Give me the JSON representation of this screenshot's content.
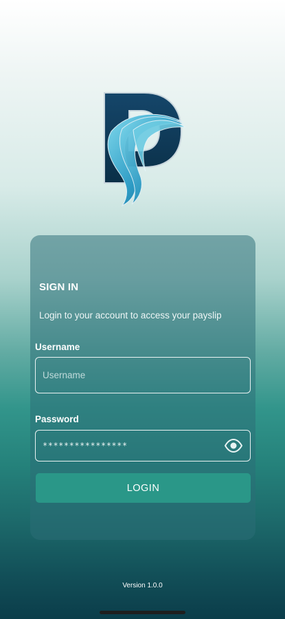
{
  "logo": {
    "icon": "payslip-p-logo-icon"
  },
  "signin": {
    "title": "SIGN IN",
    "subtitle": "Login to your account to access your payslip"
  },
  "username": {
    "label": "Username",
    "placeholder": "Username",
    "value": ""
  },
  "password": {
    "label": "Password",
    "value": "****************",
    "toggle_icon": "eye-icon"
  },
  "login_button": {
    "label": "LOGIN"
  },
  "footer": {
    "version": "Version 1.0.0"
  },
  "colors": {
    "accent": "#2a9788",
    "logo_dark": "#0e3c57",
    "logo_light": "#5ec6df"
  }
}
